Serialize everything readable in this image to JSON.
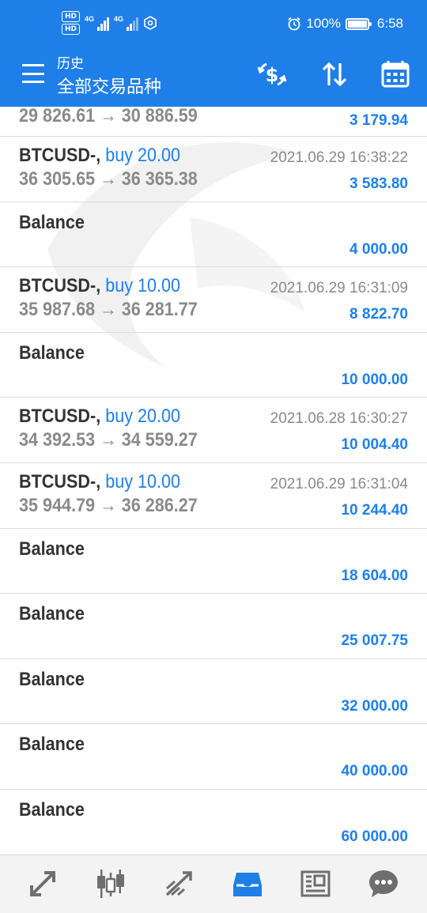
{
  "status_bar": {
    "hd_badge_1": "HD",
    "hd_badge_2": "HD",
    "network_1": "4G",
    "network_2": "4G",
    "battery_percent": "100%",
    "time": "6:58"
  },
  "app_bar": {
    "title_small": "历史",
    "title_main": "全部交易品种"
  },
  "list": {
    "partial_row": {
      "prices": "29 826.61 → 30 886.59",
      "profit": "3 179.94"
    },
    "rows": [
      {
        "kind": "trade",
        "symbol": "BTCUSD-,",
        "side": "buy 20.00",
        "time": "2021.06.29 16:38:22",
        "prices": "36 305.65 → 36 365.38",
        "profit": "3 583.80"
      },
      {
        "kind": "balance",
        "label": "Balance",
        "amount": "4 000.00"
      },
      {
        "kind": "trade",
        "symbol": "BTCUSD-,",
        "side": "buy 10.00",
        "time": "2021.06.29 16:31:09",
        "prices": "35 987.68 → 36 281.77",
        "profit": "8 822.70"
      },
      {
        "kind": "balance",
        "label": "Balance",
        "amount": "10 000.00"
      },
      {
        "kind": "trade",
        "symbol": "BTCUSD-,",
        "side": "buy 20.00",
        "time": "2021.06.28 16:30:27",
        "prices": "34 392.53 → 34 559.27",
        "profit": "10 004.40"
      },
      {
        "kind": "trade",
        "symbol": "BTCUSD-,",
        "side": "buy 10.00",
        "time": "2021.06.29 16:31:04",
        "prices": "35 944.79 → 36 286.27",
        "profit": "10 244.40"
      },
      {
        "kind": "balance",
        "label": "Balance",
        "amount": "18 604.00"
      },
      {
        "kind": "balance",
        "label": "Balance",
        "amount": "25 007.75"
      },
      {
        "kind": "balance",
        "label": "Balance",
        "amount": "32 000.00"
      },
      {
        "kind": "balance",
        "label": "Balance",
        "amount": "40 000.00"
      },
      {
        "kind": "balance",
        "label": "Balance",
        "amount": "60 000.00"
      }
    ]
  },
  "bottom_nav": {
    "items": [
      "quotes-icon",
      "chart-icon",
      "trade-icon",
      "history-icon",
      "news-icon",
      "chat-icon"
    ],
    "active": "history-icon"
  },
  "colors": {
    "accent": "#1f7fe8",
    "text_dark": "#333333",
    "text_muted": "#8a8a8a",
    "divider": "#dcdcdc",
    "nav_background": "#f3f3f3",
    "nav_icon": "#6e6e6e"
  }
}
